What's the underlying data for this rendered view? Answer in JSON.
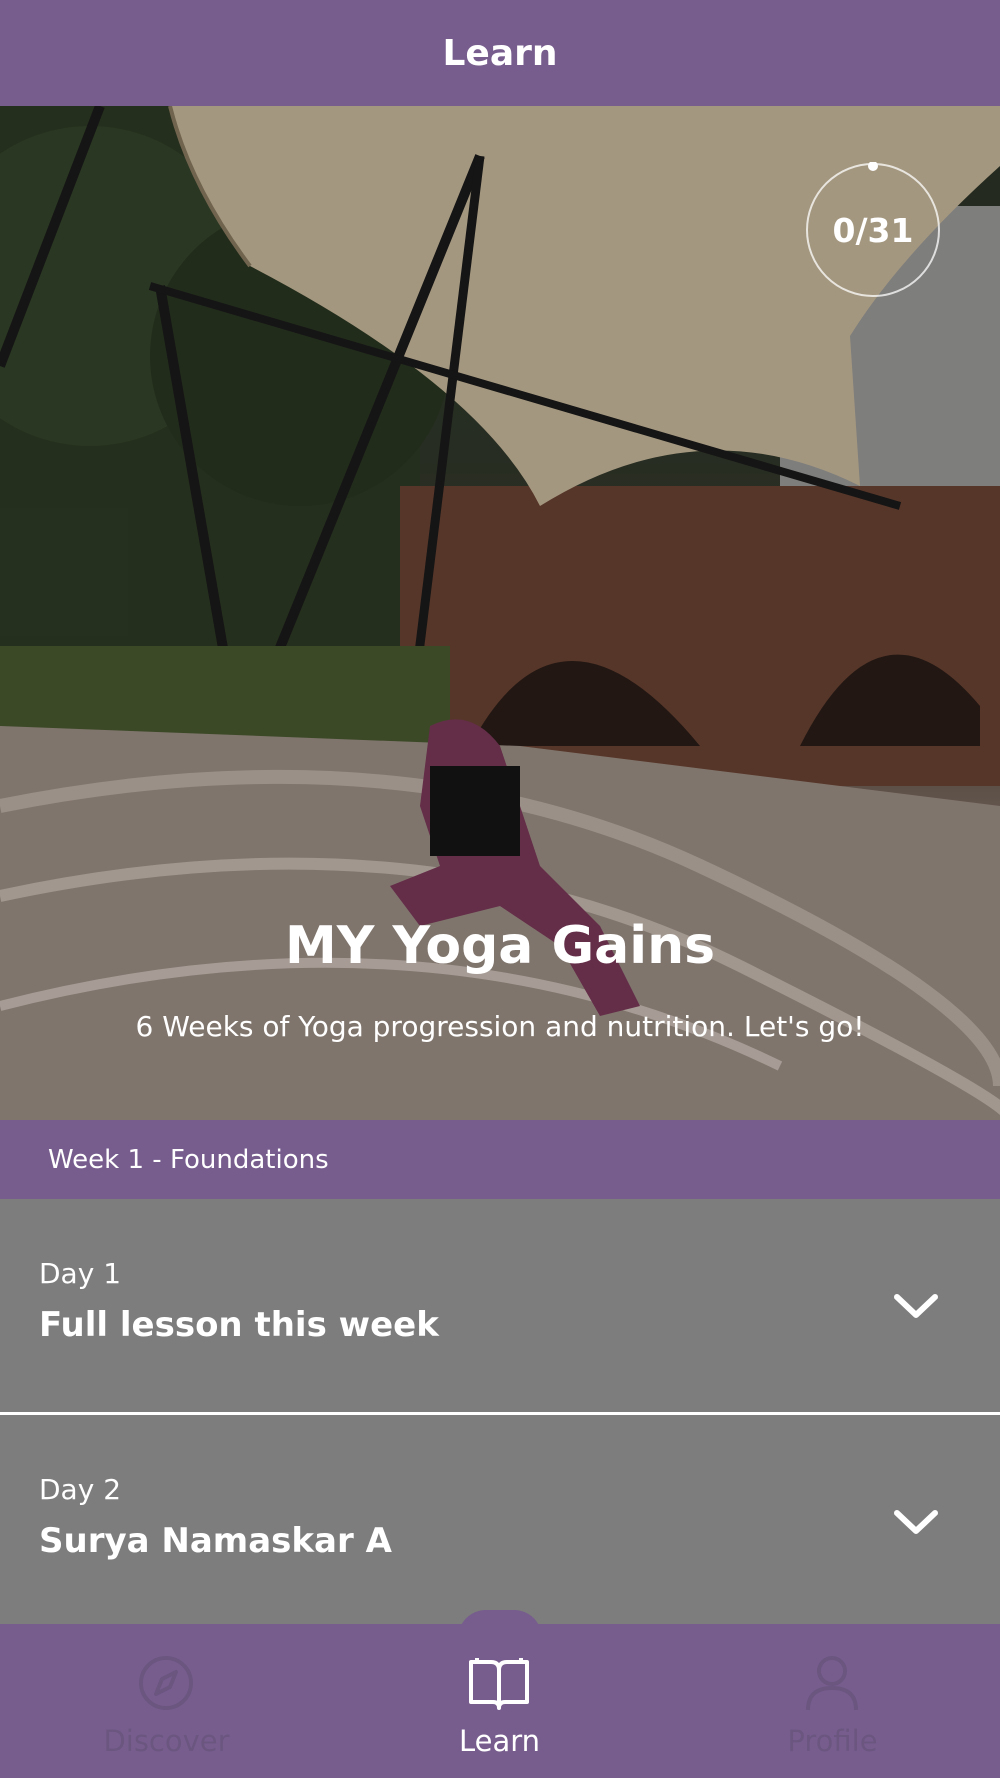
{
  "header": {
    "title": "Learn"
  },
  "program": {
    "progress_text": "0/31",
    "progress_fraction": 0.0,
    "title": "MY Yoga Gains",
    "subtitle": "6 Weeks of Yoga progression and nutrition. Let's go!"
  },
  "week": {
    "label": "Week 1 - Foundations"
  },
  "days": [
    {
      "label": "Day 1",
      "title": "Full lesson this week"
    },
    {
      "label": "Day 2",
      "title": "Surya Namaskar A"
    }
  ],
  "nav": {
    "items": [
      {
        "label": "Discover",
        "icon": "compass-icon",
        "active": false
      },
      {
        "label": "Learn",
        "icon": "book-icon",
        "active": true
      },
      {
        "label": "Profile",
        "icon": "person-icon",
        "active": false
      }
    ]
  },
  "colors": {
    "accent": "#775d8e",
    "row_bg": "#7d7d7d",
    "text": "#ffffff"
  }
}
